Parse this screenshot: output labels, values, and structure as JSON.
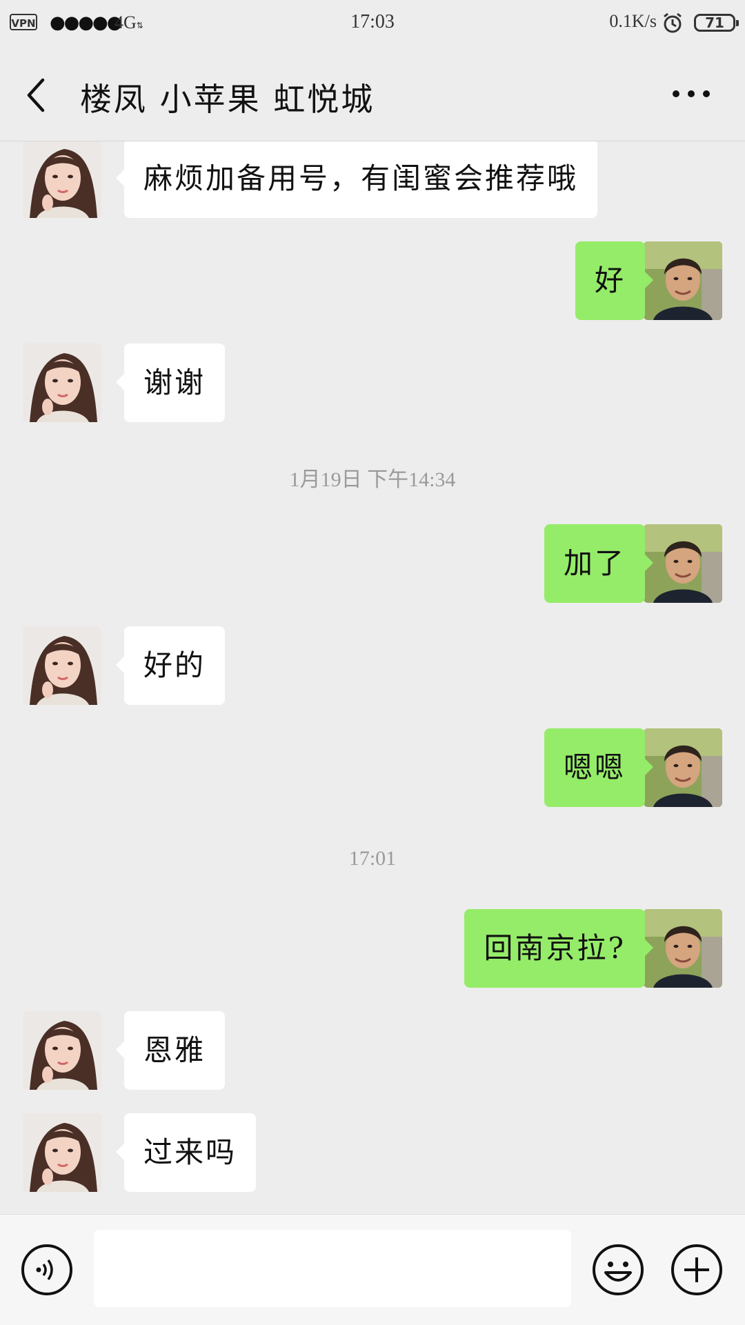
{
  "status_bar": {
    "vpn": "VPN",
    "signal": "●●●●●",
    "network": "4G",
    "time": "17:03",
    "speed": "0.1K/s",
    "battery": "71"
  },
  "header": {
    "title": "楼凤 小苹果 虹悦城"
  },
  "messages": [
    {
      "side": "left",
      "text": "麻烦加备用号，有闺蜜会推荐哦"
    },
    {
      "side": "right",
      "text": "好"
    },
    {
      "side": "left",
      "text": "谢谢"
    },
    {
      "timestamp": "1月19日 下午14:34"
    },
    {
      "side": "right",
      "text": "加了"
    },
    {
      "side": "left",
      "text": "好的"
    },
    {
      "side": "right",
      "text": "嗯嗯"
    },
    {
      "timestamp": "17:01"
    },
    {
      "side": "right",
      "text": "回南京拉?"
    },
    {
      "side": "left",
      "text": "恩雅"
    },
    {
      "side": "left",
      "text": "过来吗"
    }
  ],
  "input": {
    "value": "",
    "placeholder": ""
  },
  "colors": {
    "background": "#ededed",
    "outgoing_bubble": "#95ec69",
    "incoming_bubble": "#ffffff"
  },
  "icons": [
    "back-icon",
    "more-icon",
    "alarm-icon",
    "voice-icon",
    "emoji-icon",
    "plus-icon"
  ]
}
